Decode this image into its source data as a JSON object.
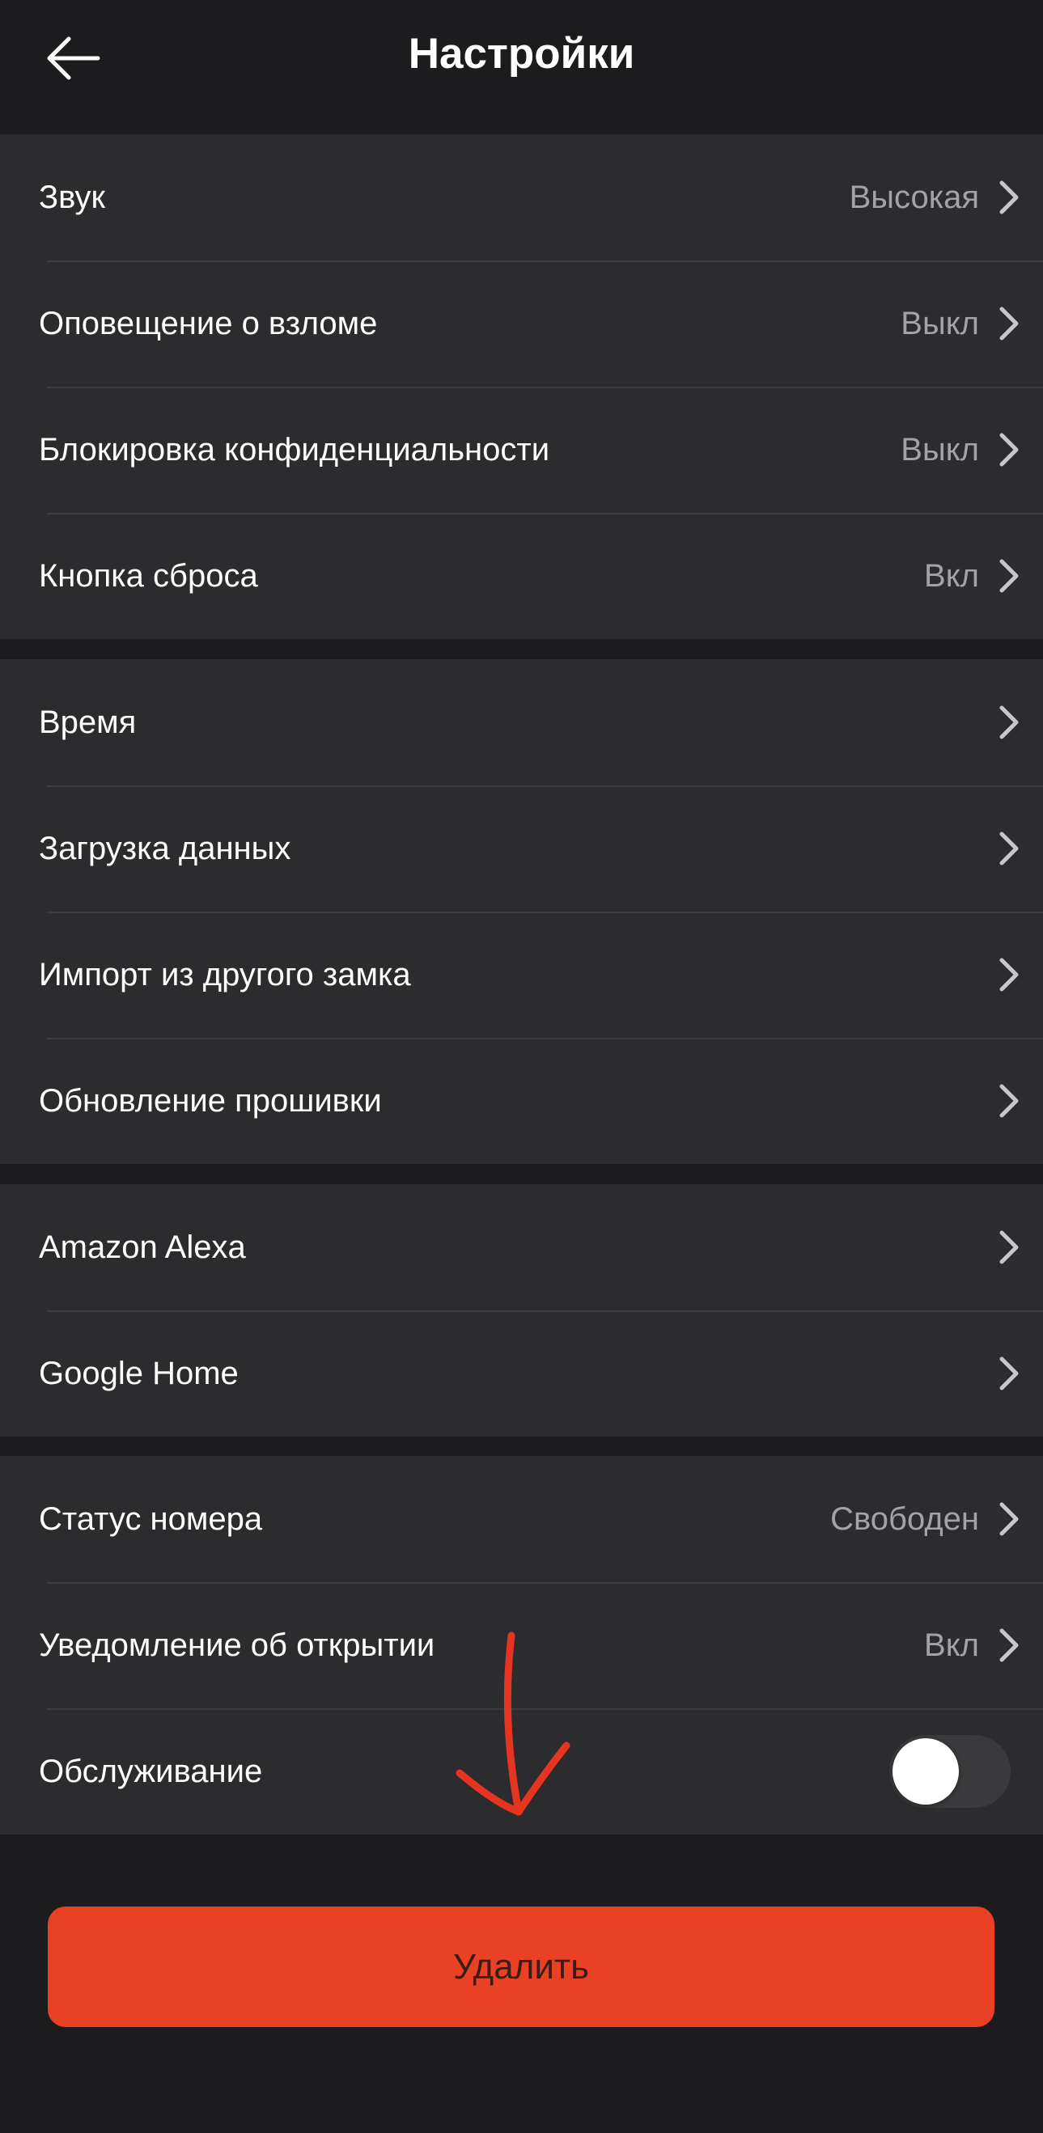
{
  "header": {
    "title": "Настройки",
    "back_icon": "arrow-left-icon"
  },
  "groups": [
    {
      "items": [
        {
          "label": "Звук",
          "value": "Высокая"
        },
        {
          "label": "Оповещение о взломе",
          "value": "Выкл"
        },
        {
          "label": "Блокировка конфиденциальности",
          "value": "Выкл"
        },
        {
          "label": "Кнопка сброса",
          "value": "Вкл"
        }
      ]
    },
    {
      "items": [
        {
          "label": "Время"
        },
        {
          "label": "Загрузка данных"
        },
        {
          "label": "Импорт из другого замка"
        },
        {
          "label": "Обновление прошивки"
        }
      ]
    },
    {
      "items": [
        {
          "label": "Amazon Alexa"
        },
        {
          "label": "Google Home"
        }
      ]
    },
    {
      "items": [
        {
          "label": "Статус номера",
          "value": "Свободен"
        },
        {
          "label": "Уведомление об открытии",
          "value": "Вкл"
        },
        {
          "label": "Обслуживание",
          "toggle_on": false
        }
      ]
    }
  ],
  "delete_button": {
    "label": "Удалить"
  },
  "colors": {
    "background": "#1c1c1e",
    "row_background": "#2c2c2e",
    "accent": "#ea4024",
    "annotation": "#e5341f"
  }
}
